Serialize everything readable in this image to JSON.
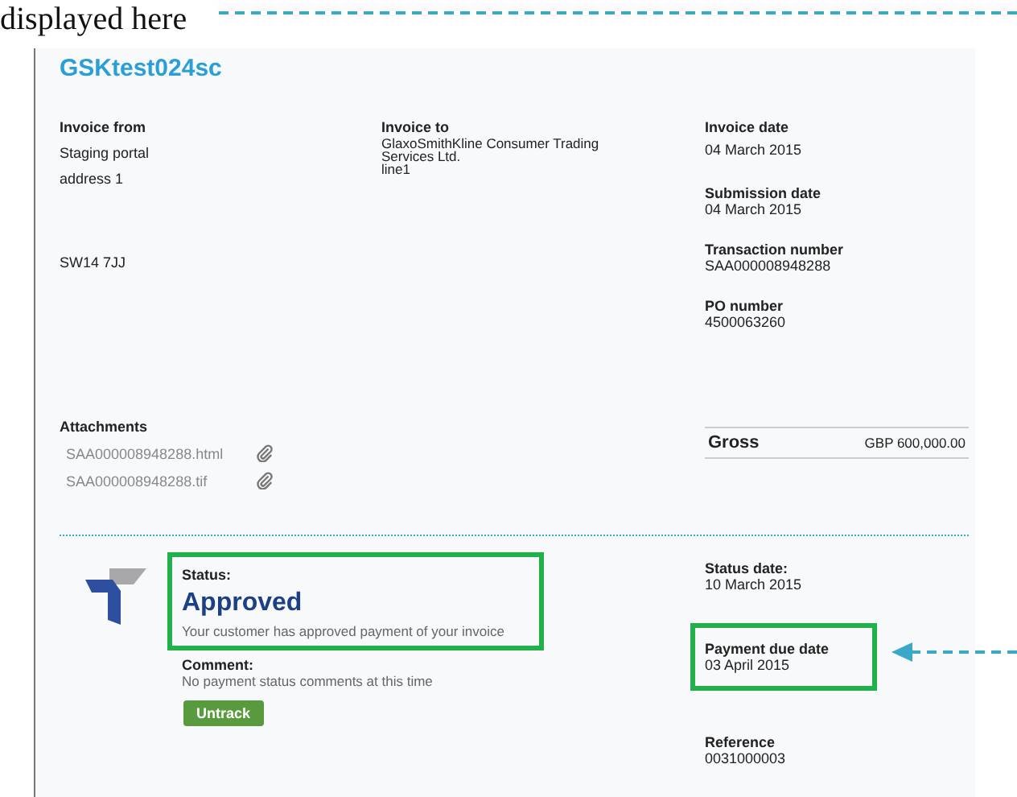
{
  "caption": "displayed here",
  "invoice": {
    "title": "GSKtest024sc",
    "from": {
      "label": "Invoice from",
      "lines": [
        "Staging portal",
        "address 1"
      ],
      "postcode": "SW14 7JJ"
    },
    "to": {
      "label": "Invoice to",
      "lines": [
        "GlaxoSmithKline Consumer Trading Services Ltd.",
        "line1"
      ]
    },
    "fields": [
      {
        "label": "Invoice date",
        "value": "04 March 2015"
      },
      {
        "label": "Submission date",
        "value": "04 March 2015"
      },
      {
        "label": "Transaction number",
        "value": "SAA000008948288"
      },
      {
        "label": "PO number",
        "value": "4500063260"
      }
    ],
    "attachments": {
      "label": "Attachments",
      "files": [
        "SAA000008948288.html",
        "SAA000008948288.tif"
      ]
    },
    "gross": {
      "label": "Gross",
      "value": "GBP 600,000.00"
    }
  },
  "status": {
    "label": "Status:",
    "value": "Approved",
    "message": "Your customer has approved payment of your invoice",
    "highlighted": true,
    "comment": {
      "label": "Comment:",
      "value": "No payment status comments at this time"
    },
    "button": "Untrack",
    "fields": [
      {
        "label": "Status date:",
        "value": "10 March 2015",
        "highlighted": false
      },
      {
        "label": "Payment due date",
        "value": "03 April 2015",
        "highlighted": true
      },
      {
        "label": "Reference",
        "value": "0031000003",
        "highlighted": false
      }
    ]
  }
}
